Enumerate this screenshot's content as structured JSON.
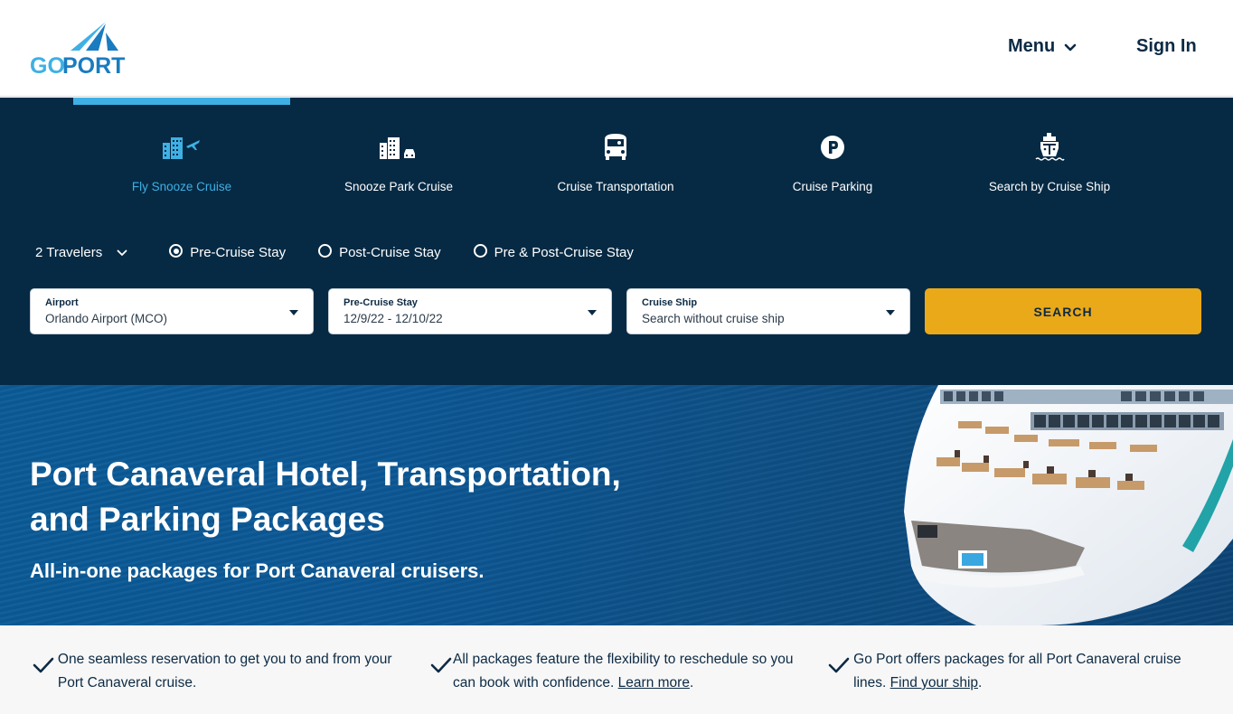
{
  "header": {
    "logo": {
      "text_go": "GO",
      "text_port": "PORT",
      "icon": "goport-sail-logo"
    },
    "menu_label": "Menu",
    "menu_icon": "chevron-down-icon",
    "signin_label": "Sign In"
  },
  "booking": {
    "tabs": [
      {
        "label": "Fly Snooze Cruise",
        "icon": "hotel-plane-icon",
        "active": true
      },
      {
        "label": "Snooze Park Cruise",
        "icon": "hotel-car-icon",
        "active": false
      },
      {
        "label": "Cruise Transportation",
        "icon": "bus-icon",
        "active": false
      },
      {
        "label": "Cruise Parking",
        "icon": "parking-icon",
        "active": false
      },
      {
        "label": "Search by Cruise Ship",
        "icon": "cruise-ship-icon",
        "active": false
      }
    ],
    "travelers": "2 Travelers",
    "stay_options": [
      {
        "label": "Pre-Cruise Stay",
        "selected": true
      },
      {
        "label": "Post-Cruise Stay",
        "selected": false
      },
      {
        "label": "Pre & Post-Cruise Stay",
        "selected": false
      }
    ],
    "fields": {
      "airport": {
        "label": "Airport",
        "value": "Orlando Airport (MCO)"
      },
      "stay": {
        "label": "Pre-Cruise Stay",
        "value": "12/9/22 - 12/10/22"
      },
      "ship": {
        "label": "Cruise Ship",
        "value": "Search without cruise ship"
      }
    },
    "search_label": "SEARCH"
  },
  "hero": {
    "title": "Port Canaveral Hotel, Transportation, and Parking Packages",
    "subtitle": "All-in-one packages for Port Canaveral cruisers."
  },
  "features": [
    {
      "text": "One seamless reservation to get you to and from your Port Canaveral cruise.",
      "link": "",
      "after": ""
    },
    {
      "text": "All packages feature the flexibility to reschedule so you can book with confidence. ",
      "link": "Learn more",
      "after": "."
    },
    {
      "text": "Go Port offers packages for all Port Canaveral cruise lines. ",
      "link": "Find your ship",
      "after": "."
    }
  ],
  "colors": {
    "navy": "#062a44",
    "accent_blue": "#3fb0e4",
    "search_yellow": "#eaa918",
    "text_dark": "#0c2a44"
  }
}
